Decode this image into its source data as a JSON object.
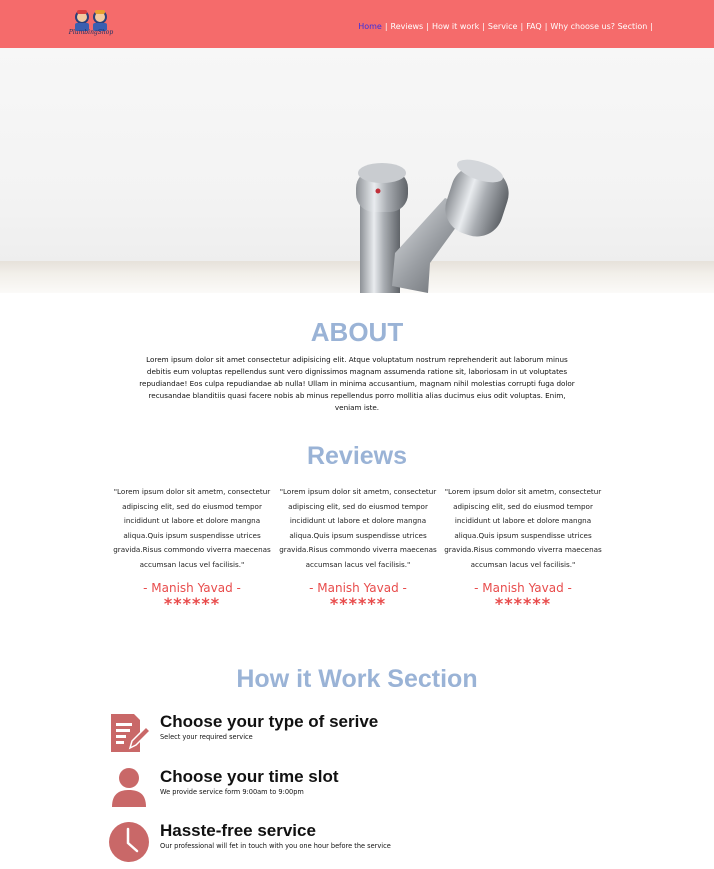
{
  "header": {
    "logo_text": "PlumbingShop",
    "nav": [
      {
        "label": "Home",
        "active": true
      },
      {
        "label": "Reviews",
        "active": false
      },
      {
        "label": "How it work",
        "active": false
      },
      {
        "label": "Service",
        "active": false
      },
      {
        "label": "FAQ",
        "active": false
      },
      {
        "label": "Why choose us? Section",
        "active": false
      }
    ],
    "separator": "|"
  },
  "about": {
    "title": "ABOUT",
    "text": "Lorem ipsum dolor sit amet consectetur adipisicing elit. Atque voluptatum nostrum reprehenderit aut laborum minus debitis eum voluptas repellendus sunt vero dignissimos magnam assumenda ratione sit, laboriosam in ut voluptates repudiandae! Eos culpa repudiandae ab nulla! Ullam in minima accusantium, magnam nihil molestias corrupti fuga dolor recusandae blanditiis quasi facere nobis ab minus repellendus porro mollitia alias ducimus eius odit voluptas. Enim, veniam iste."
  },
  "reviews": {
    "title": "Reviews",
    "items": [
      {
        "quote": "\"Lorem ipsum dolor sit ametm, consectetur adipiscing elit, sed do eiusmod tempor incididunt ut labore et dolore mangna aliqua.Quis ipsum suspendisse utrices gravida.Risus commondo viverra maecenas accumsan lacus vel facilisis.\"",
        "name": "- Manish Yavad -",
        "stars": "******"
      },
      {
        "quote": "\"Lorem ipsum dolor sit ametm, consectetur adipiscing elit, sed do eiusmod tempor incididunt ut labore et dolore mangna aliqua.Quis ipsum suspendisse utrices gravida.Risus commondo viverra maecenas accumsan lacus vel facilisis.\"",
        "name": "- Manish Yavad -",
        "stars": "******"
      },
      {
        "quote": "\"Lorem ipsum dolor sit ametm, consectetur adipiscing elit, sed do eiusmod tempor incididunt ut labore et dolore mangna aliqua.Quis ipsum suspendisse utrices gravida.Risus commondo viverra maecenas accumsan lacus vel facilisis.\"",
        "name": "- Manish Yavad -",
        "stars": "******"
      }
    ]
  },
  "how_it_works": {
    "title": "How it Work Section",
    "steps": [
      {
        "icon": "form-edit-icon",
        "title": "Choose your type of serive",
        "desc": "Select your required service"
      },
      {
        "icon": "user-icon",
        "title": "Choose your time slot",
        "desc": "We provide service form 9:00am to 9:00pm"
      },
      {
        "icon": "clock-icon",
        "title": "Hasste-free service",
        "desc": "Our professional will fet in touch with you one hour before the service"
      }
    ]
  },
  "colors": {
    "header_bg": "#f56b6b",
    "title_blue": "#9ab3d6",
    "accent_red": "#e84c4c",
    "icon_color": "#c96868"
  }
}
